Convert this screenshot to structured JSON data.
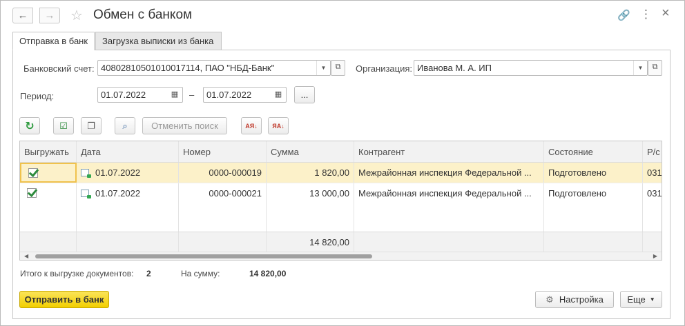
{
  "window": {
    "title": "Обмен с банком",
    "back_glyph": "←",
    "forward_glyph": "→",
    "star_glyph": "☆",
    "link_glyph": "🔗",
    "more_glyph": "⋮",
    "close_glyph": "×"
  },
  "tabs": [
    {
      "label": "Отправка в банк",
      "active": true
    },
    {
      "label": "Загрузка выписки из банка",
      "active": false
    }
  ],
  "form": {
    "bank_account_label": "Банковский счет:",
    "bank_account_value": "40802810501010017114, ПАО \"НБД-Банк\"",
    "organization_label": "Организация:",
    "organization_value": "Иванова М. А. ИП",
    "period_label": "Период:",
    "period_from": "01.07.2022",
    "period_dash": "–",
    "period_to": "01.07.2022",
    "period_select_glyph": "..."
  },
  "toolbar": {
    "cancel_search_label": "Отменить поиск",
    "sort_asc_glyph": "АЯ↓",
    "sort_desc_glyph": "ЯА↓"
  },
  "table": {
    "columns": [
      "Выгружать",
      "Дата",
      "Номер",
      "Сумма",
      "Контрагент",
      "Состояние",
      "Р/с"
    ],
    "rows": [
      {
        "export": true,
        "date": "01.07.2022",
        "number": "0000-000019",
        "sum": "1 820,00",
        "counterparty": "Межрайонная инспекция Федеральной ...",
        "status": "Подготовлено",
        "account": "031"
      },
      {
        "export": true,
        "date": "01.07.2022",
        "number": "0000-000021",
        "sum": "13 000,00",
        "counterparty": "Межрайонная инспекция Федеральной ...",
        "status": "Подготовлено",
        "account": "031"
      }
    ],
    "footer_sum": "14 820,00"
  },
  "summary": {
    "docs_label": "Итого к выгрузке документов:",
    "docs_count": "2",
    "sum_label": "На сумму:",
    "sum_value": "14 820,00"
  },
  "buttons": {
    "send_label": "Отправить в банк",
    "settings_label": "Настройка",
    "more_label": "Еще"
  },
  "colors": {
    "selected_row": "#fcf1c9",
    "send_button": "#f2cf00",
    "check": "#2e8b3d"
  }
}
